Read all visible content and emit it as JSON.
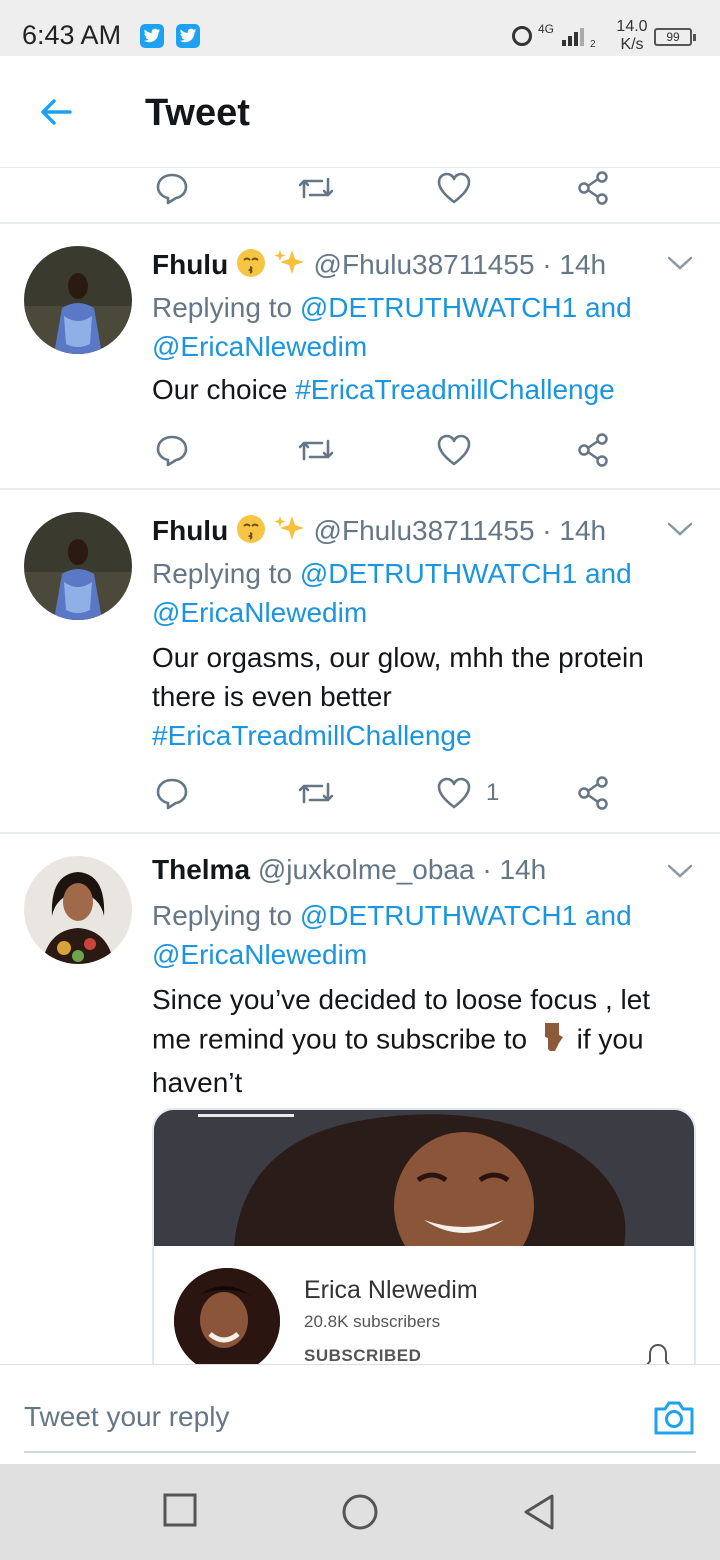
{
  "status_bar": {
    "time": "6:43 AM",
    "network": "4G",
    "sim_slot": "2",
    "speed_value": "14.0",
    "speed_unit": "K/s",
    "battery": "99"
  },
  "header": {
    "title": "Tweet"
  },
  "colors": {
    "twitter_blue": "#1b95e0",
    "secondary_text": "#657786",
    "divider": "#e6ecf0"
  },
  "tweets": [
    {
      "name": "Fhulu",
      "handle": "@Fhulu38711455",
      "time": "· 14h",
      "replying_prefix": "Replying to",
      "replying_to_1": "@DETRUTHWATCH1",
      "replying_and": "and",
      "replying_to_2": "@EricaNlewedim",
      "text_plain": "Our choice",
      "hashtag": "#EricaTreadmillChallenge",
      "likes": ""
    },
    {
      "name": "Fhulu",
      "handle": "@Fhulu38711455",
      "time": "· 14h",
      "replying_prefix": "Replying to",
      "replying_to_1": "@DETRUTHWATCH1",
      "replying_and": "and",
      "replying_to_2": "@EricaNlewedim",
      "text_line1": "Our orgasms, our glow, mhh the protein",
      "text_line2": "there is even better",
      "hashtag": "#EricaTreadmillChallenge",
      "likes": "1"
    },
    {
      "name": "Thelma",
      "handle": "@juxkolme_obaa",
      "time": "· 14h",
      "replying_prefix": "Replying to",
      "replying_to_1": "@DETRUTHWATCH1",
      "replying_and": "and",
      "replying_to_2": "@EricaNlewedim",
      "text_line1": "Since you’ve decided to loose focus , let",
      "text_line2a": "me remind you to subscribe to",
      "text_line2b": "if you",
      "text_line3": "haven’t",
      "card": {
        "channel": "Erica Nlewedim",
        "subscribers": "20.8K subscribers",
        "status": "SUBSCRIBED"
      }
    }
  ],
  "composer": {
    "placeholder": "Tweet your reply"
  },
  "icons": {
    "back": "arrow-left-icon",
    "reply": "reply-icon",
    "retweet": "retweet-icon",
    "like": "heart-icon",
    "share": "share-icon",
    "camera": "camera-icon"
  }
}
